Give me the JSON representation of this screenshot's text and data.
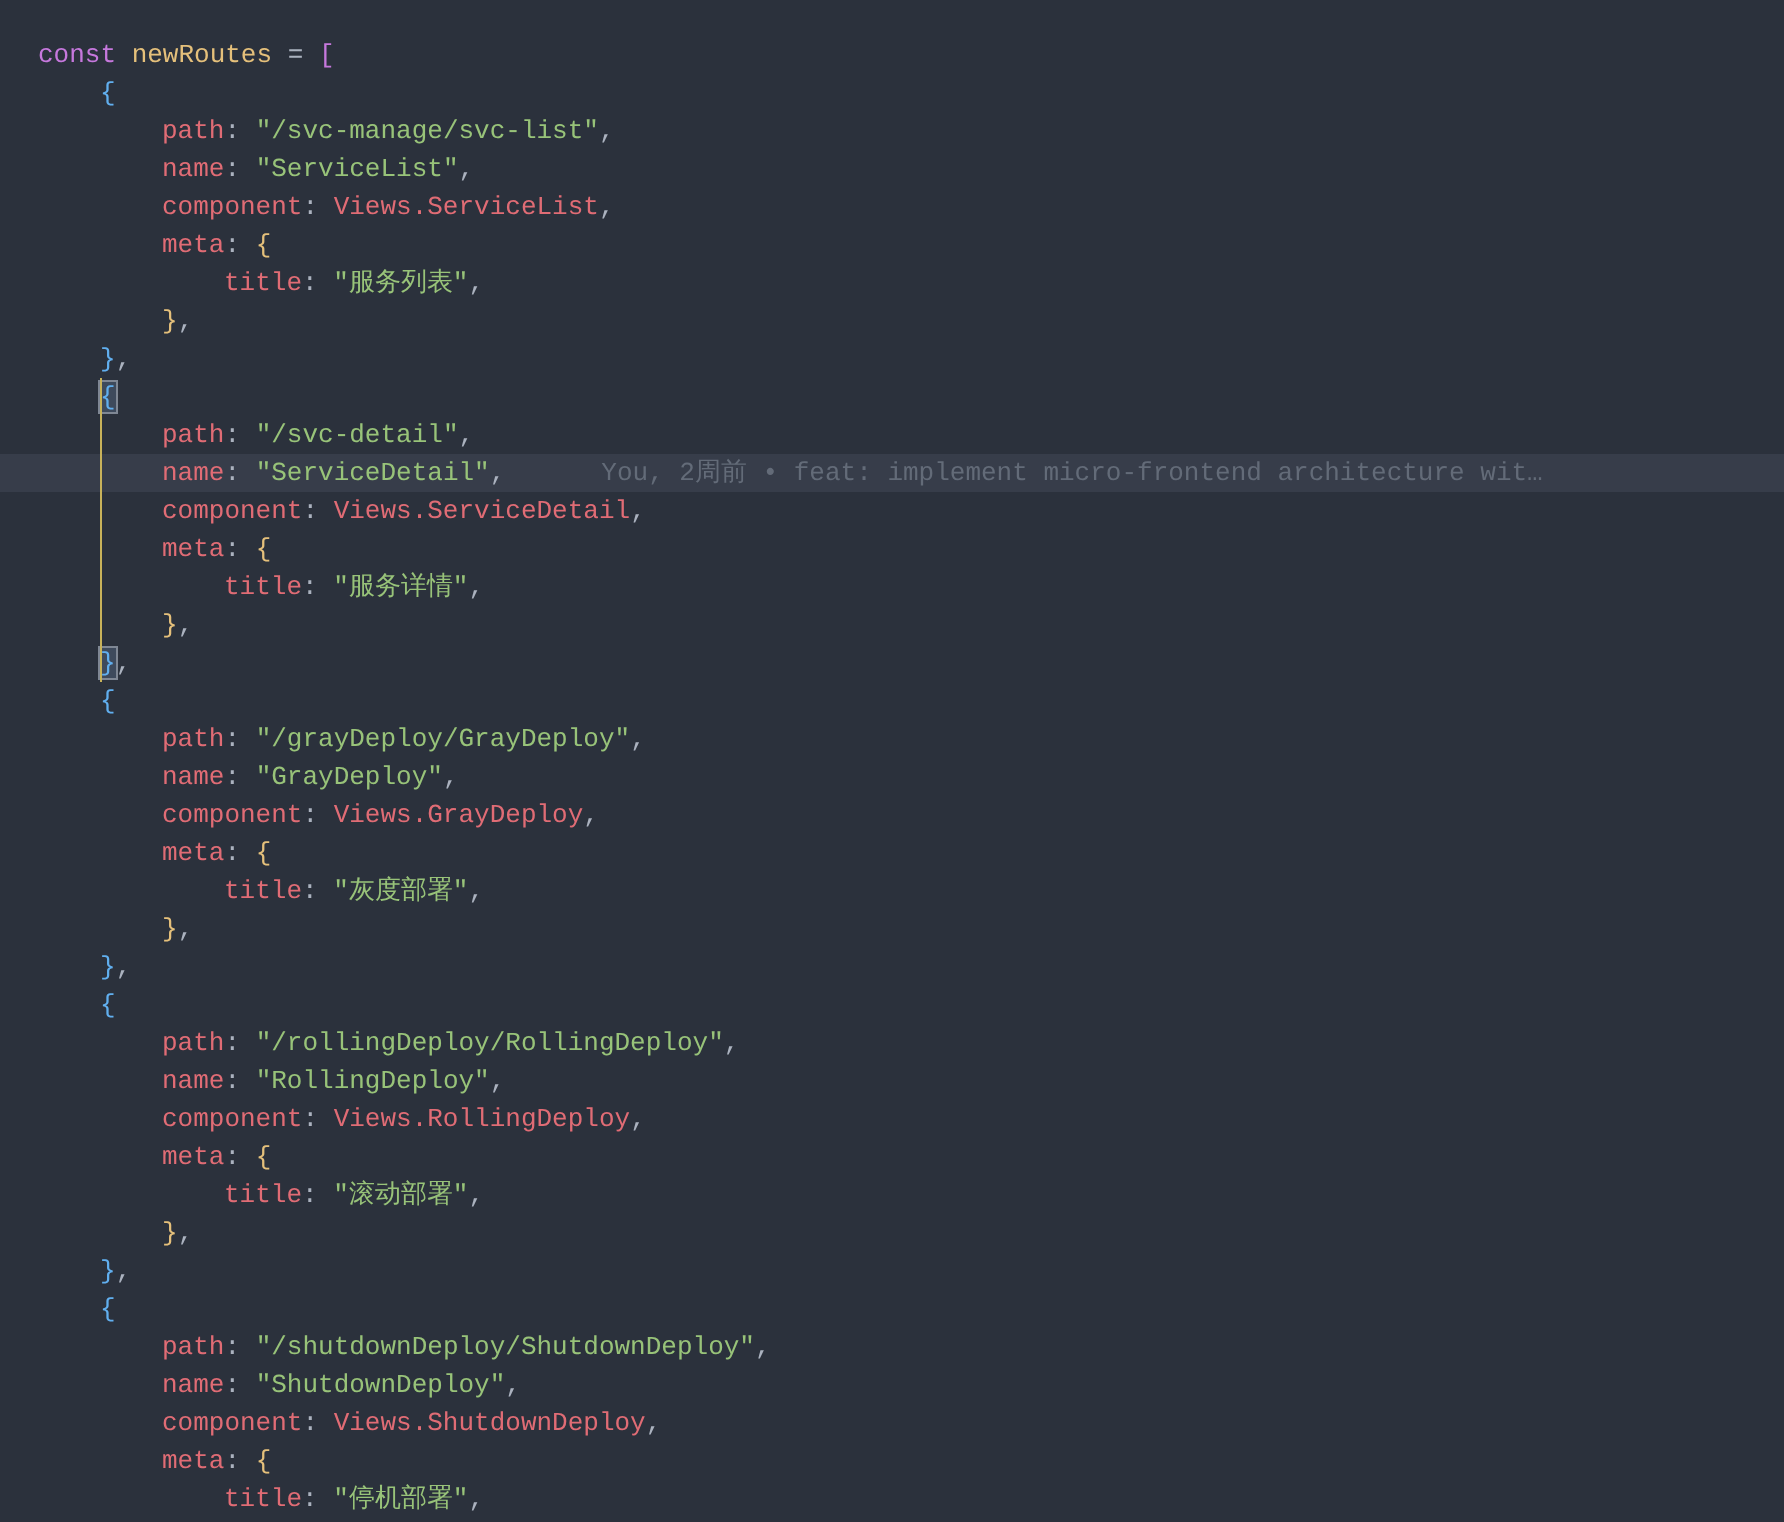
{
  "editor": {
    "lines": [
      {
        "current": false,
        "guide": false,
        "tokens": [
          {
            "text": "const",
            "kind": "kw"
          },
          {
            "text": " newRoutes",
            "kind": "var"
          },
          {
            "text": " = ",
            "kind": "punct"
          },
          {
            "text": "[",
            "kind": "b1"
          }
        ]
      },
      {
        "current": false,
        "guide": false,
        "tokens": [
          {
            "text": "{",
            "kind": "b2"
          }
        ]
      },
      {
        "current": false,
        "guide": false,
        "tokens": [
          {
            "text": "path",
            "kind": "prop"
          },
          {
            "text": ": ",
            "kind": "punct"
          },
          {
            "text": "\"/svc-manage/svc-list\"",
            "kind": "str"
          },
          {
            "text": ",",
            "kind": "punct"
          }
        ]
      },
      {
        "current": false,
        "guide": false,
        "tokens": [
          {
            "text": "name",
            "kind": "prop"
          },
          {
            "text": ": ",
            "kind": "punct"
          },
          {
            "text": "\"ServiceList\"",
            "kind": "str"
          },
          {
            "text": ",",
            "kind": "punct"
          }
        ]
      },
      {
        "current": false,
        "guide": false,
        "tokens": [
          {
            "text": "component",
            "kind": "prop"
          },
          {
            "text": ": ",
            "kind": "punct"
          },
          {
            "text": "Views.ServiceList",
            "kind": "ident"
          },
          {
            "text": ",",
            "kind": "punct"
          }
        ]
      },
      {
        "current": false,
        "guide": false,
        "tokens": [
          {
            "text": "meta",
            "kind": "prop"
          },
          {
            "text": ": ",
            "kind": "punct"
          },
          {
            "text": "{",
            "kind": "b3"
          }
        ]
      },
      {
        "current": false,
        "guide": false,
        "tokens": [
          {
            "text": "title",
            "kind": "prop"
          },
          {
            "text": ": ",
            "kind": "punct"
          },
          {
            "text": "\"服务列表\"",
            "kind": "str"
          },
          {
            "text": ",",
            "kind": "punct"
          }
        ]
      },
      {
        "current": false,
        "guide": false,
        "tokens": [
          {
            "text": "}",
            "kind": "b3"
          },
          {
            "text": ",",
            "kind": "punct"
          }
        ]
      },
      {
        "current": false,
        "guide": false,
        "tokens": [
          {
            "text": "}",
            "kind": "b2"
          },
          {
            "text": ",",
            "kind": "punct"
          }
        ]
      },
      {
        "current": false,
        "guide": true,
        "tokens": [
          {
            "text": "{",
            "kind": "match"
          }
        ]
      },
      {
        "current": false,
        "guide": true,
        "tokens": [
          {
            "text": "path",
            "kind": "prop"
          },
          {
            "text": ": ",
            "kind": "punct"
          },
          {
            "text": "\"/svc-detail\"",
            "kind": "str"
          },
          {
            "text": ",",
            "kind": "punct"
          }
        ]
      },
      {
        "current": true,
        "guide": true,
        "blame": "You, 2周前 • feat: implement micro-frontend architecture wit…",
        "tokens": [
          {
            "text": "name",
            "kind": "prop"
          },
          {
            "text": ": ",
            "kind": "punct"
          },
          {
            "text": "\"ServiceDetail\"",
            "kind": "str"
          },
          {
            "text": ",",
            "kind": "punct"
          }
        ]
      },
      {
        "current": false,
        "guide": true,
        "tokens": [
          {
            "text": "component",
            "kind": "prop"
          },
          {
            "text": ": ",
            "kind": "punct"
          },
          {
            "text": "Views.ServiceDetail",
            "kind": "ident"
          },
          {
            "text": ",",
            "kind": "punct"
          }
        ]
      },
      {
        "current": false,
        "guide": true,
        "tokens": [
          {
            "text": "meta",
            "kind": "prop"
          },
          {
            "text": ": ",
            "kind": "punct"
          },
          {
            "text": "{",
            "kind": "b3"
          }
        ]
      },
      {
        "current": false,
        "guide": true,
        "tokens": [
          {
            "text": "title",
            "kind": "prop"
          },
          {
            "text": ": ",
            "kind": "punct"
          },
          {
            "text": "\"服务详情\"",
            "kind": "str"
          },
          {
            "text": ",",
            "kind": "punct"
          }
        ]
      },
      {
        "current": false,
        "guide": true,
        "tokens": [
          {
            "text": "}",
            "kind": "b3"
          },
          {
            "text": ",",
            "kind": "punct"
          }
        ]
      },
      {
        "current": false,
        "guide": true,
        "tokens": [
          {
            "text": "}",
            "kind": "match"
          },
          {
            "text": ",",
            "kind": "punct"
          }
        ]
      },
      {
        "current": false,
        "guide": false,
        "tokens": [
          {
            "text": "{",
            "kind": "b2"
          }
        ]
      },
      {
        "current": false,
        "guide": false,
        "tokens": [
          {
            "text": "path",
            "kind": "prop"
          },
          {
            "text": ": ",
            "kind": "punct"
          },
          {
            "text": "\"/grayDeploy/GrayDeploy\"",
            "kind": "str"
          },
          {
            "text": ",",
            "kind": "punct"
          }
        ]
      },
      {
        "current": false,
        "guide": false,
        "tokens": [
          {
            "text": "name",
            "kind": "prop"
          },
          {
            "text": ": ",
            "kind": "punct"
          },
          {
            "text": "\"GrayDeploy\"",
            "kind": "str"
          },
          {
            "text": ",",
            "kind": "punct"
          }
        ]
      },
      {
        "current": false,
        "guide": false,
        "tokens": [
          {
            "text": "component",
            "kind": "prop"
          },
          {
            "text": ": ",
            "kind": "punct"
          },
          {
            "text": "Views.GrayDeploy",
            "kind": "ident"
          },
          {
            "text": ",",
            "kind": "punct"
          }
        ]
      },
      {
        "current": false,
        "guide": false,
        "tokens": [
          {
            "text": "meta",
            "kind": "prop"
          },
          {
            "text": ": ",
            "kind": "punct"
          },
          {
            "text": "{",
            "kind": "b3"
          }
        ]
      },
      {
        "current": false,
        "guide": false,
        "tokens": [
          {
            "text": "title",
            "kind": "prop"
          },
          {
            "text": ": ",
            "kind": "punct"
          },
          {
            "text": "\"灰度部署\"",
            "kind": "str"
          },
          {
            "text": ",",
            "kind": "punct"
          }
        ]
      },
      {
        "current": false,
        "guide": false,
        "tokens": [
          {
            "text": "}",
            "kind": "b3"
          },
          {
            "text": ",",
            "kind": "punct"
          }
        ]
      },
      {
        "current": false,
        "guide": false,
        "tokens": [
          {
            "text": "}",
            "kind": "b2"
          },
          {
            "text": ",",
            "kind": "punct"
          }
        ]
      },
      {
        "current": false,
        "guide": false,
        "tokens": [
          {
            "text": "{",
            "kind": "b2"
          }
        ]
      },
      {
        "current": false,
        "guide": false,
        "tokens": [
          {
            "text": "path",
            "kind": "prop"
          },
          {
            "text": ": ",
            "kind": "punct"
          },
          {
            "text": "\"/rollingDeploy/RollingDeploy\"",
            "kind": "str"
          },
          {
            "text": ",",
            "kind": "punct"
          }
        ]
      },
      {
        "current": false,
        "guide": false,
        "tokens": [
          {
            "text": "name",
            "kind": "prop"
          },
          {
            "text": ": ",
            "kind": "punct"
          },
          {
            "text": "\"RollingDeploy\"",
            "kind": "str"
          },
          {
            "text": ",",
            "kind": "punct"
          }
        ]
      },
      {
        "current": false,
        "guide": false,
        "tokens": [
          {
            "text": "component",
            "kind": "prop"
          },
          {
            "text": ": ",
            "kind": "punct"
          },
          {
            "text": "Views.RollingDeploy",
            "kind": "ident"
          },
          {
            "text": ",",
            "kind": "punct"
          }
        ]
      },
      {
        "current": false,
        "guide": false,
        "tokens": [
          {
            "text": "meta",
            "kind": "prop"
          },
          {
            "text": ": ",
            "kind": "punct"
          },
          {
            "text": "{",
            "kind": "b3"
          }
        ]
      },
      {
        "current": false,
        "guide": false,
        "tokens": [
          {
            "text": "title",
            "kind": "prop"
          },
          {
            "text": ": ",
            "kind": "punct"
          },
          {
            "text": "\"滚动部署\"",
            "kind": "str"
          },
          {
            "text": ",",
            "kind": "punct"
          }
        ]
      },
      {
        "current": false,
        "guide": false,
        "tokens": [
          {
            "text": "}",
            "kind": "b3"
          },
          {
            "text": ",",
            "kind": "punct"
          }
        ]
      },
      {
        "current": false,
        "guide": false,
        "tokens": [
          {
            "text": "}",
            "kind": "b2"
          },
          {
            "text": ",",
            "kind": "punct"
          }
        ]
      },
      {
        "current": false,
        "guide": false,
        "tokens": [
          {
            "text": "{",
            "kind": "b2"
          }
        ]
      },
      {
        "current": false,
        "guide": false,
        "tokens": [
          {
            "text": "path",
            "kind": "prop"
          },
          {
            "text": ": ",
            "kind": "punct"
          },
          {
            "text": "\"/shutdownDeploy/ShutdownDeploy\"",
            "kind": "str"
          },
          {
            "text": ",",
            "kind": "punct"
          }
        ]
      },
      {
        "current": false,
        "guide": false,
        "tokens": [
          {
            "text": "name",
            "kind": "prop"
          },
          {
            "text": ": ",
            "kind": "punct"
          },
          {
            "text": "\"ShutdownDeploy\"",
            "kind": "str"
          },
          {
            "text": ",",
            "kind": "punct"
          }
        ]
      },
      {
        "current": false,
        "guide": false,
        "tokens": [
          {
            "text": "component",
            "kind": "prop"
          },
          {
            "text": ": ",
            "kind": "punct"
          },
          {
            "text": "Views.ShutdownDeploy",
            "kind": "ident"
          },
          {
            "text": ",",
            "kind": "punct"
          }
        ]
      },
      {
        "current": false,
        "guide": false,
        "tokens": [
          {
            "text": "meta",
            "kind": "prop"
          },
          {
            "text": ": ",
            "kind": "punct"
          },
          {
            "text": "{",
            "kind": "b3"
          }
        ]
      },
      {
        "current": false,
        "guide": false,
        "tokens": [
          {
            "text": "title",
            "kind": "prop"
          },
          {
            "text": ": ",
            "kind": "punct"
          },
          {
            "text": "\"停机部署\"",
            "kind": "str"
          },
          {
            "text": ",",
            "kind": "punct"
          }
        ]
      }
    ]
  }
}
